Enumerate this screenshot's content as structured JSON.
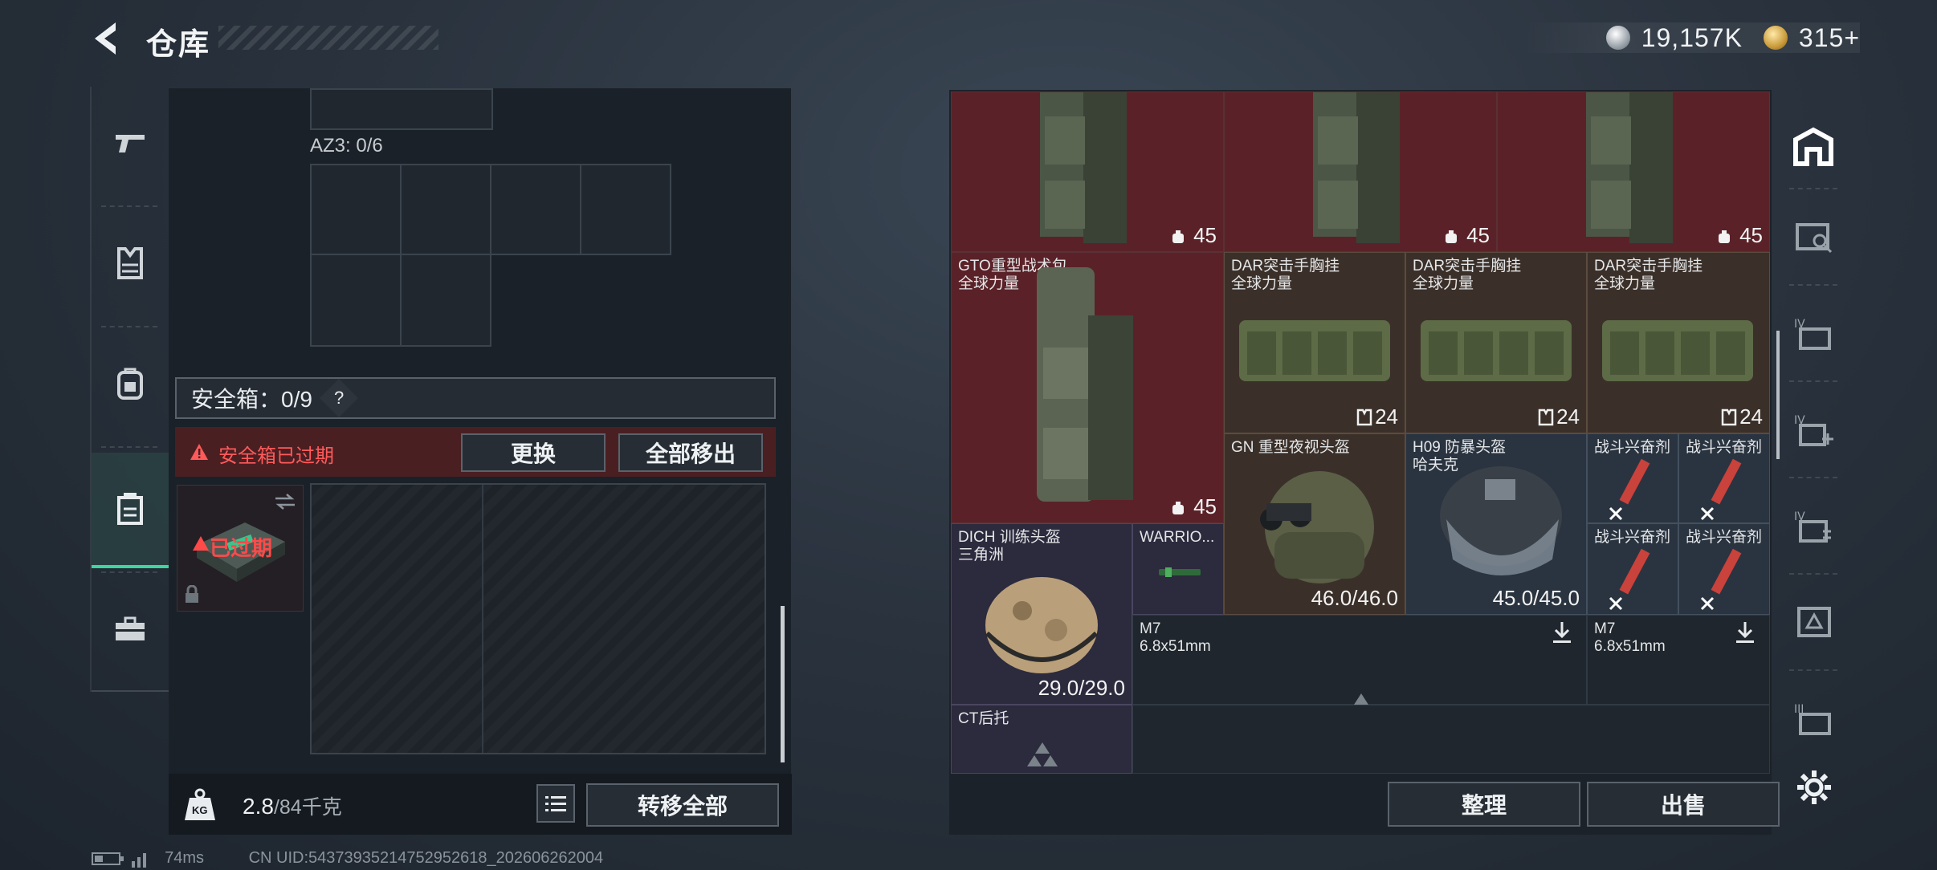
{
  "header": {
    "title": "仓库",
    "back_icon": "back-arrow-icon"
  },
  "currency": {
    "coin_value": "19,157K",
    "token_value": "315+",
    "coin_color": "#c9ced3",
    "token_color": "#d6b25a"
  },
  "left_nav": {
    "items": [
      {
        "name": "weapon",
        "icon": "pistol-icon"
      },
      {
        "name": "armor",
        "icon": "vest-icon"
      },
      {
        "name": "backpack",
        "icon": "backpack-icon"
      },
      {
        "name": "safebox",
        "icon": "safebox-icon",
        "active": true
      },
      {
        "name": "toolbox",
        "icon": "toolbox-icon"
      }
    ]
  },
  "storage": {
    "az3_label": "AZ3: 0/6"
  },
  "safebox": {
    "label": "安全箱：0/9",
    "help": "?",
    "expired_notice": "安全箱已过期",
    "replace_button": "更换",
    "remove_all_button": "全部移出",
    "case_status": "已过期"
  },
  "bottom_left": {
    "weight_value": "2.8",
    "weight_max": "/84千克",
    "kg_badge": "KG",
    "transfer_all_button": "转移全部"
  },
  "items": {
    "row1_num": [
      "45",
      "45",
      "45"
    ],
    "gto": {
      "name": "GTO重型战术包",
      "sub": "全球力量",
      "num": "45"
    },
    "dar": [
      {
        "name": "DAR突击手胸挂",
        "sub": "全球力量",
        "num": "24"
      },
      {
        "name": "DAR突击手胸挂",
        "sub": "全球力量",
        "num": "24"
      },
      {
        "name": "DAR突击手胸挂",
        "sub": "全球力量",
        "num": "24"
      }
    ],
    "gn": {
      "name": "GN 重型夜视头盔",
      "num": "46.0/46.0"
    },
    "h09": {
      "name": "H09 防暴头盔",
      "sub": "哈夫克",
      "num": "45.0/45.0"
    },
    "stim": [
      "战斗兴奋剂",
      "战斗兴奋剂",
      "战斗兴奋剂",
      "战斗兴奋剂"
    ],
    "dich": {
      "name": "DICH 训练头盔",
      "sub": "三角洲",
      "num": "29.0/29.0"
    },
    "warrior": {
      "name": "WARRIO..."
    },
    "m7_a": {
      "name": "M7",
      "sub": "6.8x51mm"
    },
    "m7_b": {
      "name": "M7",
      "sub": "6.8x51mm"
    },
    "ct": {
      "name": "CT后托"
    }
  },
  "bottom_right": {
    "sort_button": "整理",
    "sell_button": "出售"
  },
  "right_nav": {
    "items": [
      "home-icon",
      "vault-1-icon",
      "vault-4-icon",
      "vault-4-add-icon",
      "vault-4-swap-icon",
      "vault-triangle-icon",
      "vault-3-icon"
    ],
    "settings_icon": "gear-icon"
  },
  "status": {
    "ping": "74ms",
    "uid": "CN UID:54373935214752952618_202606262004"
  }
}
